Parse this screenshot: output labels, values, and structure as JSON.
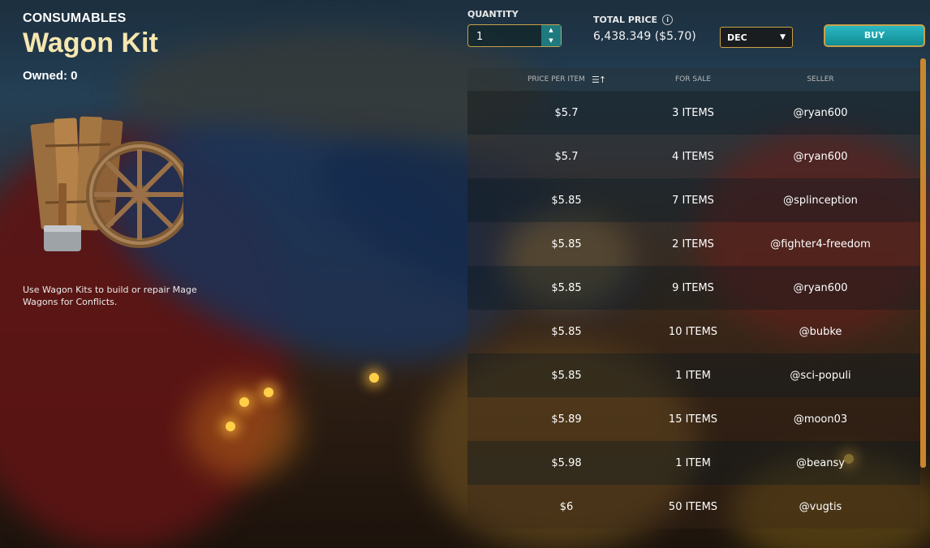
{
  "item": {
    "category": "CONSUMABLES",
    "name": "Wagon Kit",
    "owned": "Owned: 0",
    "description": "Use Wagon Kits to build or repair Mage Wagons for Conflicts."
  },
  "purchase": {
    "quantity_label": "QUANTITY",
    "quantity_value": "1",
    "total_label": "TOTAL PRICE",
    "total_value": "6,438.349 ($5.70)",
    "currency": "DEC",
    "buy_label": "BUY"
  },
  "table": {
    "headers": {
      "price": "PRICE PER ITEM",
      "for_sale": "FOR SALE",
      "seller": "SELLER"
    },
    "rows": [
      {
        "price": "$5.7",
        "for_sale": "3 ITEMS",
        "seller": "@ryan600"
      },
      {
        "price": "$5.7",
        "for_sale": "4 ITEMS",
        "seller": "@ryan600"
      },
      {
        "price": "$5.85",
        "for_sale": "7 ITEMS",
        "seller": "@splinception"
      },
      {
        "price": "$5.85",
        "for_sale": "2 ITEMS",
        "seller": "@fighter4-freedom"
      },
      {
        "price": "$5.85",
        "for_sale": "9 ITEMS",
        "seller": "@ryan600"
      },
      {
        "price": "$5.85",
        "for_sale": "10 ITEMS",
        "seller": "@bubke"
      },
      {
        "price": "$5.85",
        "for_sale": "1 ITEM",
        "seller": "@sci-populi"
      },
      {
        "price": "$5.89",
        "for_sale": "15 ITEMS",
        "seller": "@moon03"
      },
      {
        "price": "$5.98",
        "for_sale": "1 ITEM",
        "seller": "@beansy"
      },
      {
        "price": "$6",
        "for_sale": "50 ITEMS",
        "seller": "@vugtis"
      }
    ]
  },
  "icons": {
    "info": "info-icon",
    "sort": "sort-ascending-icon",
    "stepper_up": "chevron-up-icon",
    "stepper_down": "chevron-down-icon",
    "select": "chevron-down-icon"
  },
  "colors": {
    "title": "#f6e7b0",
    "accent_gold": "#c9a24a",
    "buy_teal": "#1a9ea7",
    "scrollbar": "#c9862e"
  }
}
